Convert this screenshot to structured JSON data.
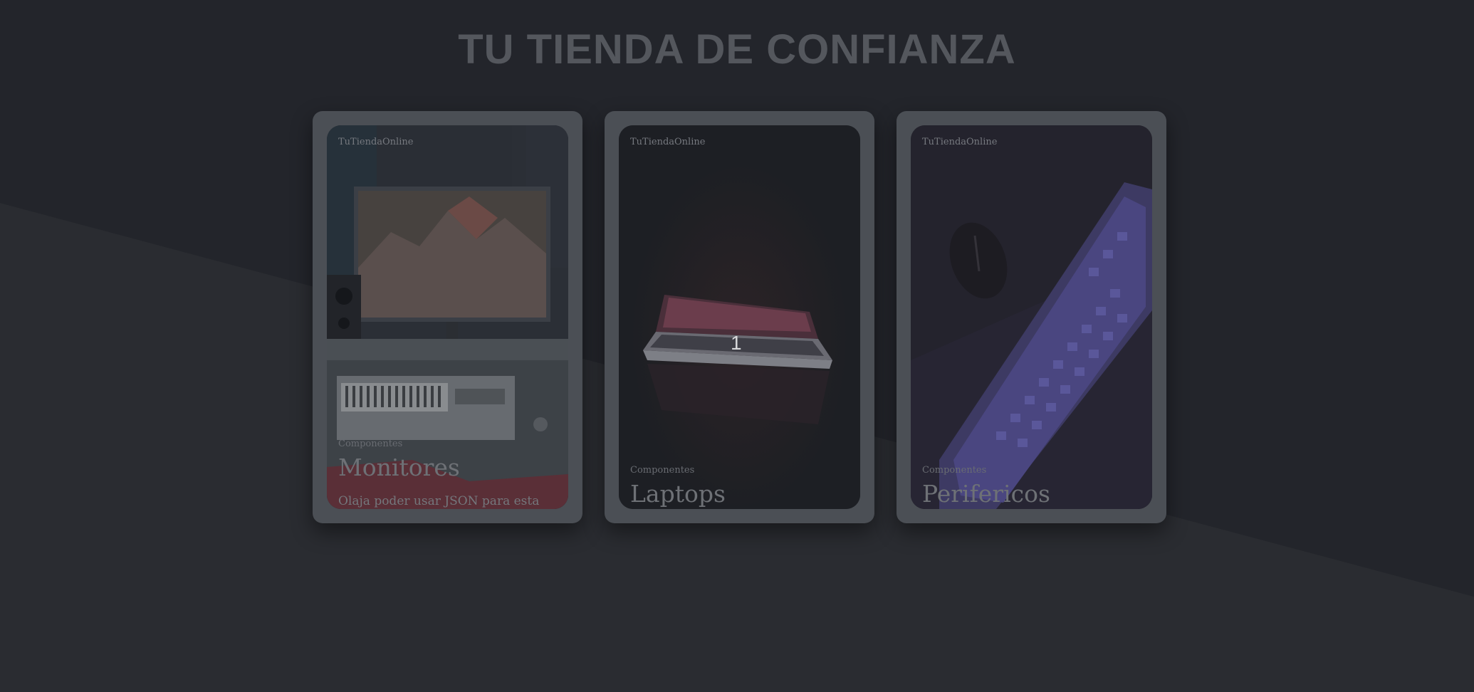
{
  "page": {
    "title": "TU TIENDA DE CONFIANZA"
  },
  "cards": [
    {
      "brand": "TuTiendaOnline",
      "category": "Componentes",
      "title": "Monitores",
      "description": "Olaja poder usar JSON para esta",
      "image": "studio-desk-monitor-keyboard-photo"
    },
    {
      "brand": "TuTiendaOnline",
      "category": "Componentes",
      "title": "Laptops",
      "badge": "1",
      "image": "laptop-in-dark-photo"
    },
    {
      "brand": "TuTiendaOnline",
      "category": "Componentes",
      "title": "Perifericos",
      "image": "keyboard-and-mouse-photo"
    }
  ],
  "colors": {
    "background": "#24262c",
    "card_frame": "#4b4f55",
    "title": "#54575d"
  }
}
